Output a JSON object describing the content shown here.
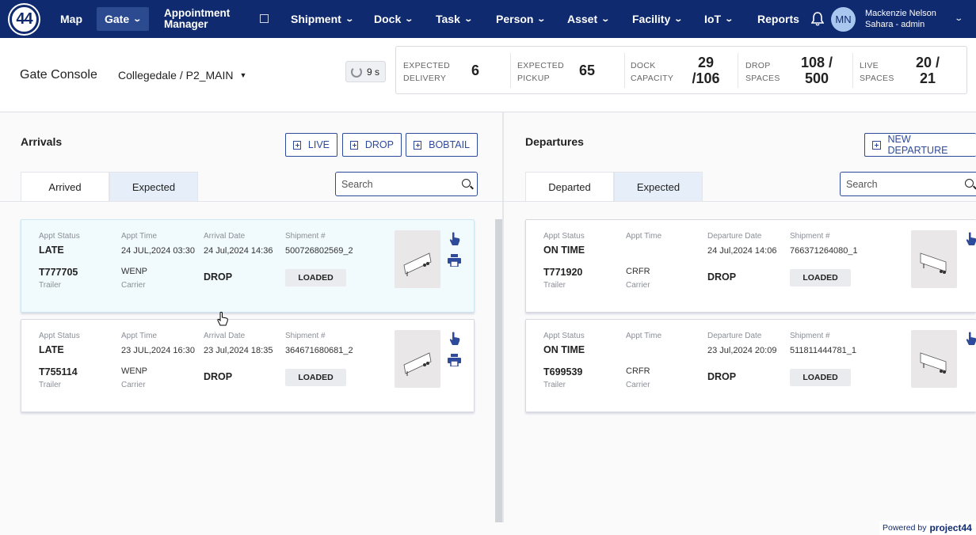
{
  "nav": {
    "logo": "44",
    "items": [
      {
        "label": "Map"
      },
      {
        "label": "Gate"
      },
      {
        "label": "Appointment Manager"
      },
      {
        "label": "Shipment"
      },
      {
        "label": "Dock"
      },
      {
        "label": "Task"
      },
      {
        "label": "Person"
      },
      {
        "label": "Asset"
      },
      {
        "label": "Facility"
      },
      {
        "label": "IoT"
      },
      {
        "label": "Reports"
      }
    ],
    "user_initials": "MN",
    "user_name": "Mackenzie Nelson",
    "user_role": "Sahara - admin"
  },
  "header": {
    "title": "Gate Console",
    "site": "Collegedale / P2_MAIN",
    "refresh": "9 s",
    "stats": [
      {
        "label1": "EXPECTED",
        "label2": "DELIVERY",
        "value1": "6",
        "value2": ""
      },
      {
        "label1": "EXPECTED",
        "label2": "PICKUP",
        "value1": "65",
        "value2": ""
      },
      {
        "label1": "DOCK",
        "label2": "CAPACITY",
        "value1": "29",
        "value2": "/106"
      },
      {
        "label1": "DROP",
        "label2": "SPACES",
        "value1": "108 /",
        "value2": "500"
      },
      {
        "label1": "LIVE",
        "label2": "SPACES",
        "value1": "20 /",
        "value2": "21"
      }
    ]
  },
  "arrivals": {
    "title": "Arrivals",
    "buttons": [
      "LIVE",
      "DROP",
      "BOBTAIL"
    ],
    "tabs": [
      "Arrived",
      "Expected"
    ],
    "search_placeholder": "Search",
    "cards": [
      {
        "f_status": "Appt Status",
        "status": "LATE",
        "f_appt": "Appt Time",
        "appt_time": "24 JUL,2024 03:30",
        "f_date": "Arrival Date",
        "date": "24 Jul,2024 14:36",
        "f_ship": "Shipment #",
        "shipment": "500726802569_2",
        "trailer": "T777705",
        "f_trailer": "Trailer",
        "carrier": "WENP",
        "f_carrier": "Carrier",
        "type": "DROP",
        "badge": "LOADED"
      },
      {
        "f_status": "Appt Status",
        "status": "LATE",
        "f_appt": "Appt Time",
        "appt_time": "23 JUL,2024 16:30",
        "f_date": "Arrival Date",
        "date": "23 Jul,2024 18:35",
        "f_ship": "Shipment #",
        "shipment": "364671680681_2",
        "trailer": "T755114",
        "f_trailer": "Trailer",
        "carrier": "WENP",
        "f_carrier": "Carrier",
        "type": "DROP",
        "badge": "LOADED"
      }
    ]
  },
  "departures": {
    "title": "Departures",
    "button": "NEW DEPARTURE",
    "tabs": [
      "Departed",
      "Expected"
    ],
    "search_placeholder": "Search",
    "cards": [
      {
        "f_status": "Appt Status",
        "status": "ON TIME",
        "f_appt": "Appt Time",
        "appt_time": "",
        "f_date": "Departure Date",
        "date": "24 Jul,2024 14:06",
        "f_ship": "Shipment #",
        "shipment": "766371264080_1",
        "trailer": "T771920",
        "f_trailer": "Trailer",
        "carrier": "CRFR",
        "f_carrier": "Carrier",
        "type": "DROP",
        "badge": "LOADED"
      },
      {
        "f_status": "Appt Status",
        "status": "ON TIME",
        "f_appt": "Appt Time",
        "appt_time": "",
        "f_date": "Departure Date",
        "date": "23 Jul,2024 20:09",
        "f_ship": "Shipment #",
        "shipment": "511811444781_1",
        "trailer": "T699539",
        "f_trailer": "Trailer",
        "carrier": "CRFR",
        "f_carrier": "Carrier",
        "type": "DROP",
        "badge": "LOADED"
      }
    ]
  },
  "footer": {
    "powered_by": "Powered by",
    "brand": "project44"
  },
  "colors": {
    "nav_bg": "#0f2a6e",
    "accent": "#2e4a9a",
    "tab_inactive": "#e6eef9",
    "card_highlight": "#f1fafd"
  }
}
